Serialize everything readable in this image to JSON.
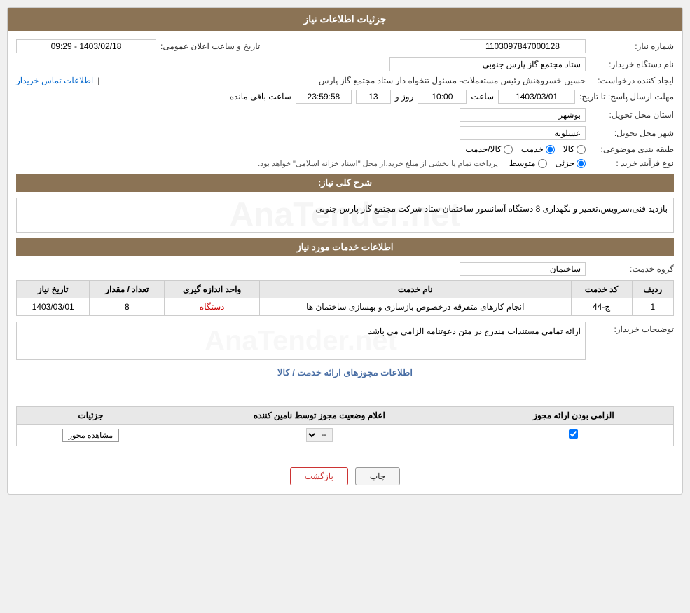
{
  "page": {
    "title": "جزئیات اطلاعات نیاز"
  },
  "fields": {
    "shomara_niaz_label": "شماره نیاز:",
    "shomara_niaz_value": "1103097847000128",
    "nam_dastgah_label": "نام دستگاه خریدار:",
    "nam_dastgah_value": "ستاد مجتمع گاز پارس جنوبی",
    "ijad_konande_label": "ایجاد کننده درخواست:",
    "ijad_konande_value": "حسین خسروهنش رئیس مستعملات- مسئول تنخواه دار  ستاد مجتمع گاز پارس",
    "contact_link": "اطلاعات تماس خریدار",
    "mohlat_label": "مهلت ارسال پاسخ: تا تاریخ:",
    "date_value": "1403/03/01",
    "saat_label": "ساعت",
    "saat_value": "10:00",
    "roz_label": "روز و",
    "roz_value": "13",
    "countdown_value": "23:59:58",
    "countdown_label": "ساعت باقی مانده",
    "tarikh_label": "تاریخ و ساعت اعلان عمومی:",
    "tarikh_value": "1403/02/18 - 09:29",
    "ostan_label": "استان محل تحویل:",
    "ostan_value": "بوشهر",
    "shahr_label": "شهر محل تحویل:",
    "shahr_value": "عسلویه",
    "tabaqe_label": "طبقه بندی موضوعی:",
    "tabaqe_kala": "کالا",
    "tabaqe_khadamat": "خدمت",
    "tabaqe_kala_khadamat": "کالا/خدمت",
    "noee_farayand_label": "نوع فرآیند خرید :",
    "noee_jozii": "جزئی",
    "noee_motovaset": "متوسط",
    "noee_description": "پرداخت تمام یا بخشی از مبلغ خرید،از محل \"اسناد خزانه اسلامی\" خواهد بود.",
    "sharh_label": "شرح کلی نیاز:",
    "sharh_value": "بازدید فنی،سرویس،تعمیر و نگهداری 8 دستگاه آسانسور ساختمان ستاد شرکت مجتمع گاز پارس جنوبی",
    "khadamat_section": "اطلاعات خدمات مورد نیاز",
    "goroh_khadamat_label": "گروه خدمت:",
    "goroh_khadamat_value": "ساختمان",
    "table": {
      "headers": [
        "ردیف",
        "کد خدمت",
        "نام خدمت",
        "واحد اندازه گیری",
        "تعداد / مقدار",
        "تاریخ نیاز"
      ],
      "rows": [
        {
          "radif": "1",
          "code": "ج-44",
          "name": "انجام کارهای متفرقه درخصوص بازسازی و بهسازی ساختمان ها",
          "unit": "دستگاه",
          "count": "8",
          "date": "1403/03/01"
        }
      ]
    },
    "tosihaat_label": "توضیحات خریدار:",
    "tosihaat_value": "ارائه تمامی مستندات مندرج در متن دعوتنامه الزامی می باشد",
    "mojavez_section": "اطلاعات مجوزهای ارائه خدمت / کالا",
    "perm_table": {
      "headers": [
        "الزامی بودن ارائه مجوز",
        "اعلام وضعیت مجوز توسط نامین کننده",
        "جزئیات"
      ],
      "rows": [
        {
          "elzami": true,
          "status": "--",
          "details_btn": "مشاهده مجوز"
        }
      ]
    },
    "btn_print": "چاپ",
    "btn_back": "بازگشت"
  }
}
